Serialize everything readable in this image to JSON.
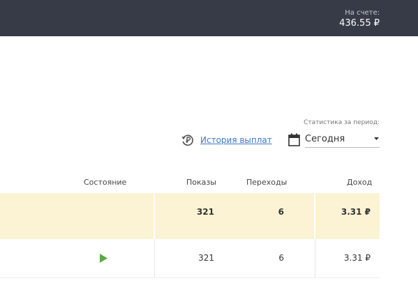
{
  "header": {
    "balance_label": "На счете:",
    "balance_value": "436.55 ₽"
  },
  "controls": {
    "period_label": "Статистика за период:",
    "history_link": "История выплат",
    "period_value": "Сегодня"
  },
  "table": {
    "columns": [
      "Состояние",
      "Показы",
      "Переходы",
      "Доход"
    ],
    "total": {
      "views": "321",
      "clicks": "6",
      "income": "3.31 ₽"
    },
    "rows": [
      {
        "state": "play-icon",
        "views": "321",
        "clicks": "6",
        "income": "3.31 ₽"
      }
    ]
  },
  "colors": {
    "topbar": "#363b47",
    "link": "#3f79c9",
    "total_row": "#fcf3d4",
    "play": "#5aab3f"
  }
}
